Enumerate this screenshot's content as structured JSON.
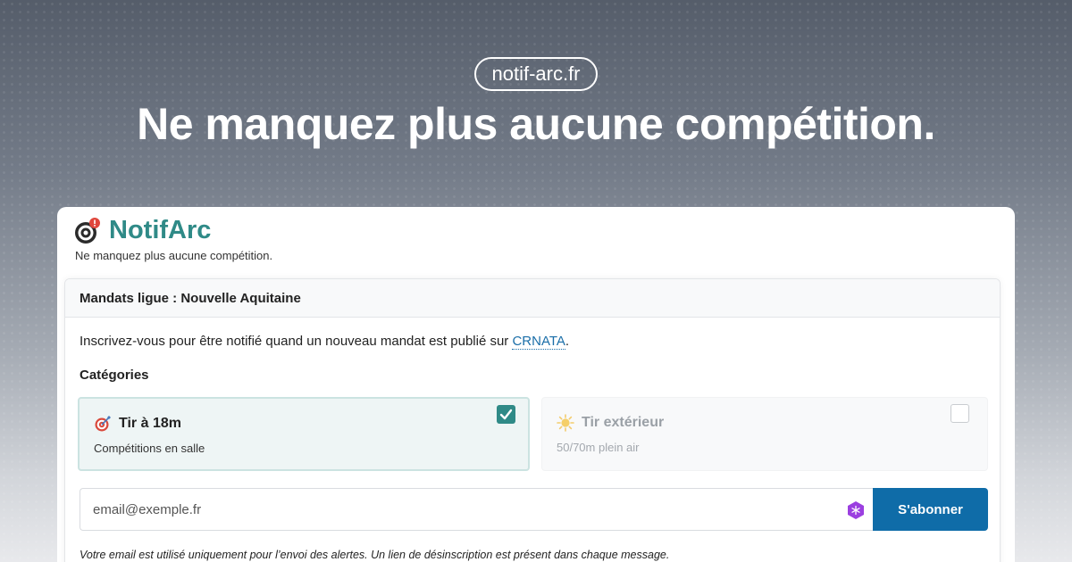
{
  "domain_pill": "notif-arc.fr",
  "headline": "Ne manquez plus aucune compétition.",
  "brand": {
    "name": "NotifArc",
    "tagline": "Ne manquez plus aucune compétition.",
    "icon": "target-bell-icon",
    "color": "#2f8a87"
  },
  "card": {
    "title": "Mandats ligue : Nouvelle Aquitaine",
    "intro_text": "Inscrivez-vous pour être notifié quand un nouveau mandat est publié sur ",
    "intro_link": "CRNATA",
    "intro_end": ".",
    "categories_title": "Catégories",
    "options": [
      {
        "title": "Tir à 18m",
        "subtitle": "Compétitions en salle",
        "icon": "target-icon",
        "checked": true
      },
      {
        "title": "Tir extérieur",
        "subtitle": "50/70m plein air",
        "icon": "sun-icon",
        "checked": false
      }
    ],
    "email_placeholder": "email@exemple.fr",
    "subscribe_label": "S'abonner",
    "note": "Votre email est utilisé uniquement pour l’envoi des alertes. Un lien de désinscription est présent dans chaque message."
  },
  "colors": {
    "accent": "#2f8a87",
    "button": "#0f6ca8",
    "link": "#1a6ea8"
  }
}
